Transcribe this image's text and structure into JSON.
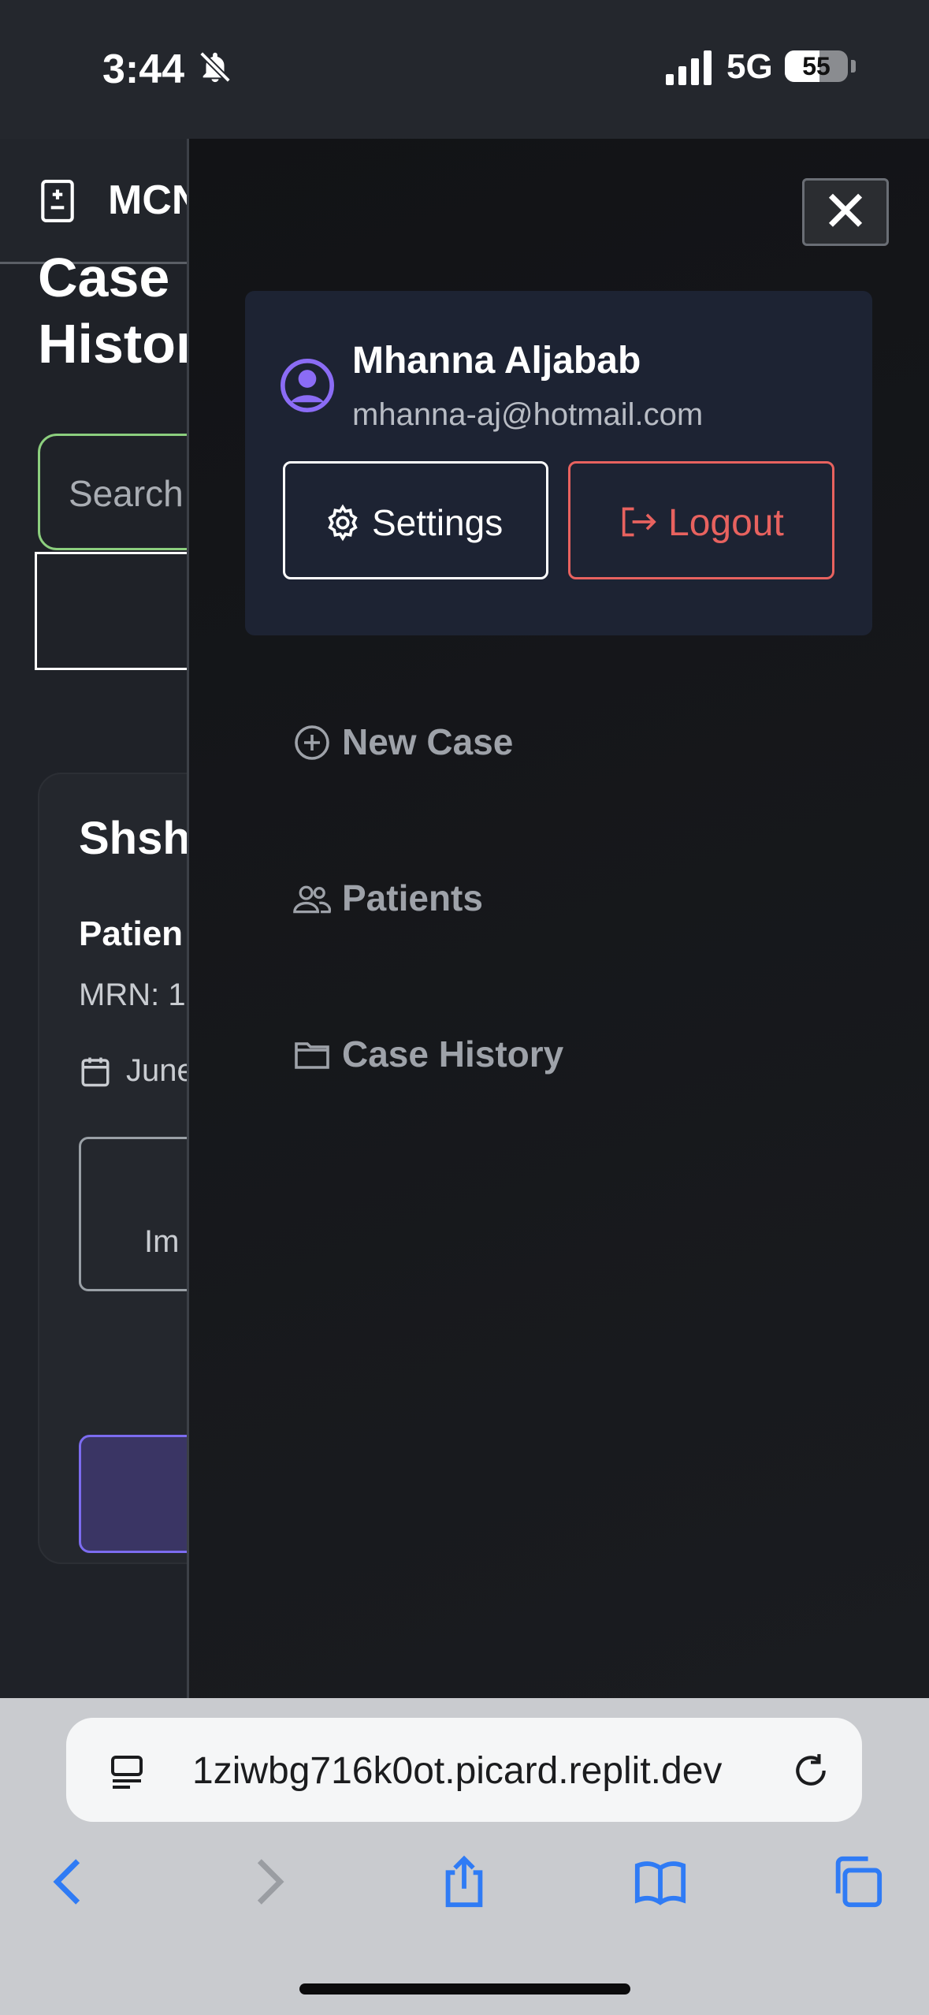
{
  "status_bar": {
    "time": "3:44",
    "network": "5G",
    "battery": "55",
    "battery_level": 0.55
  },
  "app": {
    "brand": "MCN",
    "page_title": "Case History",
    "search_placeholder": "Search",
    "case": {
      "title": "Shsh",
      "patient_label": "Patien",
      "mrn": "MRN: 1",
      "date": "June",
      "image_label": "Im"
    }
  },
  "drawer": {
    "close_icon": "close-icon",
    "user": {
      "name": "Mhanna Aljabab",
      "email": "mhanna-aj@hotmail.com"
    },
    "settings_label": "Settings",
    "logout_label": "Logout",
    "nav": [
      {
        "label": "New Case",
        "icon": "plus-circle-icon"
      },
      {
        "label": "Patients",
        "icon": "users-icon"
      },
      {
        "label": "Case History",
        "icon": "folder-icon"
      }
    ]
  },
  "browser": {
    "url": "1ziwbg716k0ot.picard.replit.dev"
  },
  "colors": {
    "accent": "#7c6cf0",
    "logout": "#e8625f",
    "search_border": "#8ccf7e",
    "profile_card": "#1d2333"
  }
}
